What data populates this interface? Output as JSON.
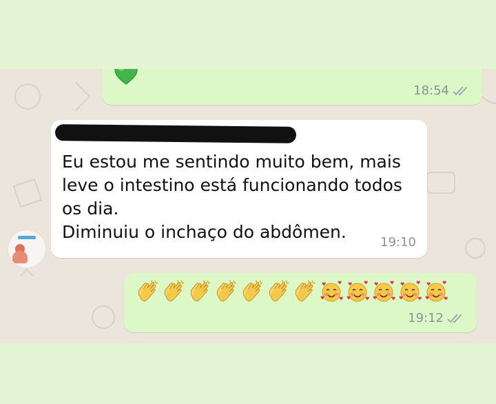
{
  "messages": [
    {
      "direction": "outgoing",
      "content": "green-heart-emoji",
      "time": "18:54",
      "status": "read"
    },
    {
      "direction": "incoming",
      "sender_redacted": true,
      "text": "Eu estou me sentindo muito bem, mais\nleve o intestino está funcionando todos\nos dia.\nDiminuiu o inchaço do abdômen.",
      "time": "19:10"
    },
    {
      "direction": "outgoing",
      "emojis": [
        "clapping-hands",
        "clapping-hands",
        "clapping-hands",
        "clapping-hands",
        "clapping-hands",
        "clapping-hands",
        "clapping-hands",
        "smiling-face-with-hearts",
        "smiling-face-with-hearts",
        "smiling-face-with-hearts",
        "smiling-face-with-hearts",
        "smiling-face-with-hearts"
      ],
      "time": "19:12",
      "status": "read"
    }
  ],
  "colors": {
    "outgoing_bubble": "#dcf8c6",
    "incoming_bubble": "#ffffff",
    "chat_background": "#ece5dc",
    "frame_background": "#e3f3d3",
    "timestamp": "#8a9499"
  }
}
